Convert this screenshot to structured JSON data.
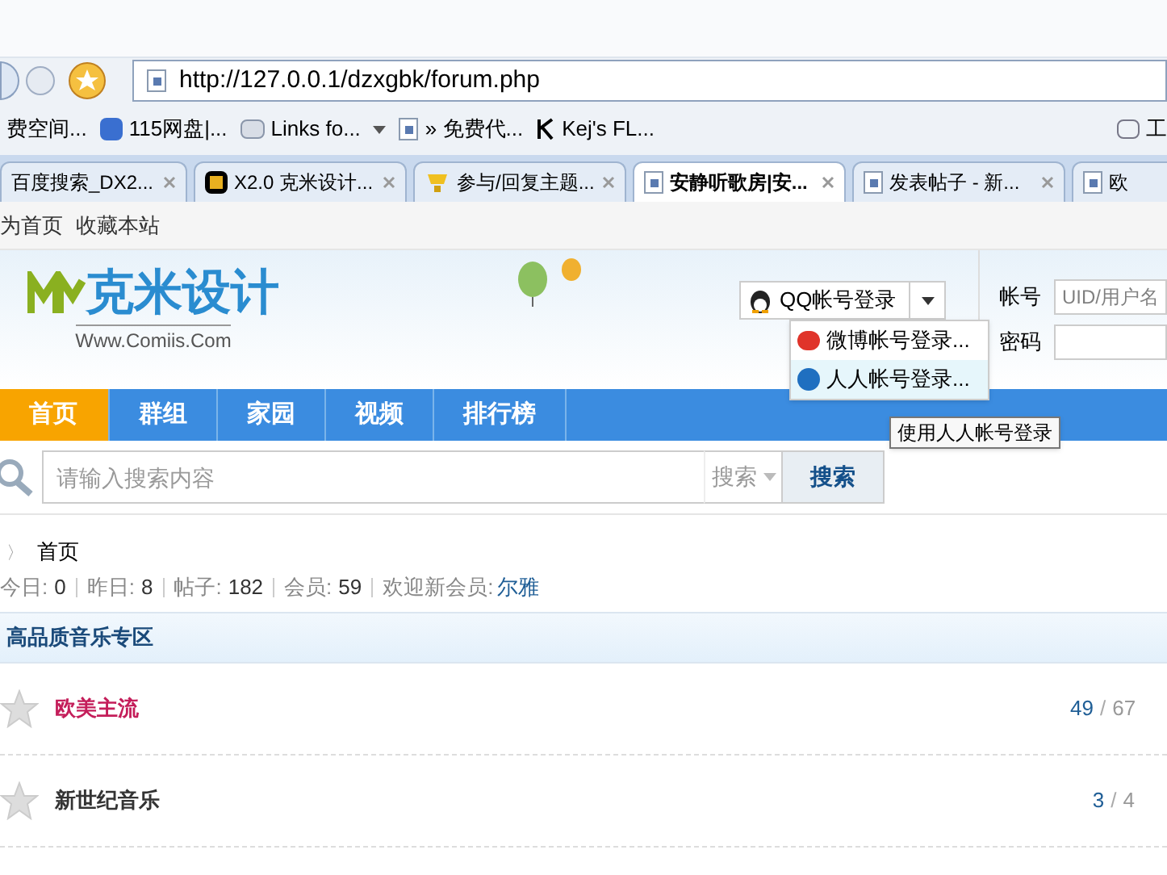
{
  "browser": {
    "address": "http://127.0.0.1/dzxgbk/forum.php",
    "bookmarks": [
      {
        "label": "费空间...",
        "kind": "plain"
      },
      {
        "label": "115网盘|...",
        "kind": "square"
      },
      {
        "label": "Links fo...",
        "kind": "folder",
        "dropdown": true
      },
      {
        "label": "» 免费代...",
        "kind": "page"
      },
      {
        "label": "Kej's FL...",
        "kind": "letter"
      }
    ],
    "bookmark_end": "工",
    "tabs": [
      {
        "label": "百度搜索_DX2...",
        "kind": "plain",
        "selected": false,
        "closable": true
      },
      {
        "label": "X2.0 克米设计...",
        "kind": "logo",
        "selected": false,
        "closable": true
      },
      {
        "label": "参与/回复主题...",
        "kind": "trophy",
        "selected": false,
        "closable": true
      },
      {
        "label": "安静听歌房|安...",
        "kind": "page",
        "selected": true,
        "closable": true
      },
      {
        "label": "发表帖子 - 新...",
        "kind": "page",
        "selected": false,
        "closable": true
      },
      {
        "label": "欧",
        "kind": "page",
        "selected": false,
        "closable": false
      }
    ]
  },
  "site": {
    "top_links": [
      "为首页",
      "收藏本站"
    ],
    "logo": {
      "text": "克米设计",
      "subtitle": "Www.Comiis.Com"
    },
    "login": {
      "button": "QQ帐号登录",
      "menu": [
        {
          "label": "微博帐号登录...",
          "kind": "weibo",
          "selected": false
        },
        {
          "label": "人人帐号登录...",
          "kind": "renren",
          "selected": true
        }
      ],
      "tooltip": "使用人人帐号登录",
      "account_label": "帐号",
      "account_placeholder": "UID/用户名",
      "password_label": "密码"
    },
    "nav": [
      {
        "label": "首页",
        "selected": true
      },
      {
        "label": "群组",
        "selected": false
      },
      {
        "label": "家园",
        "selected": false
      },
      {
        "label": "视频",
        "selected": false
      },
      {
        "label": "排行榜",
        "selected": false
      }
    ],
    "search": {
      "placeholder": "请输入搜索内容",
      "type": "搜索",
      "button": "搜索"
    },
    "breadcrumb_separator": "〉",
    "breadcrumb": "首页",
    "stats": [
      {
        "label": "今日:",
        "value": "0"
      },
      {
        "label": "昨日:",
        "value": "8"
      },
      {
        "label": "帖子:",
        "value": "182"
      },
      {
        "label": "会员:",
        "value": "59"
      }
    ],
    "new_member": {
      "label": "欢迎新会员:",
      "name": "尔雅"
    },
    "section": "高品质音乐专区",
    "forums": [
      {
        "name": "欧美主流",
        "color": "#c41e5a",
        "threads": "49",
        "separator": "/",
        "posts": "67"
      },
      {
        "name": "新世纪音乐",
        "color": "#333333",
        "threads": "3",
        "separator": "/",
        "posts": "4"
      }
    ]
  }
}
